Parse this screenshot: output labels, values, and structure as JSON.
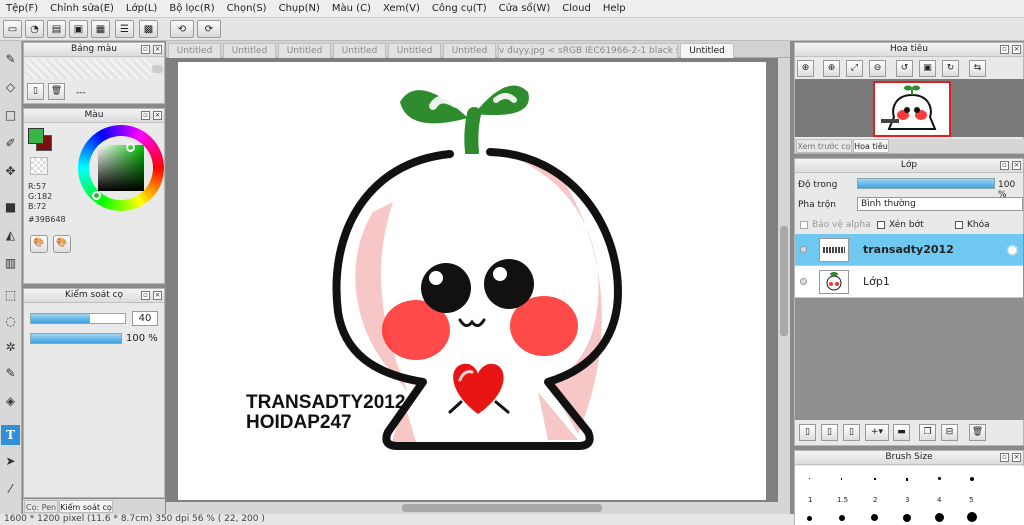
{
  "menu": [
    "Tệp(F)",
    "Chỉnh sửa(E)",
    "Lớp(L)",
    "Bộ lọc(R)",
    "Chọn(S)",
    "Chụp(N)",
    "Màu (C)",
    "Xem(V)",
    "Công cụ(T)",
    "Cửa sổ(W)",
    "Cloud",
    "Help"
  ],
  "tabs": [
    "Untitled",
    "Untitled",
    "Untitled",
    "Untitled",
    "Untitled",
    "Untitled",
    "v đuyy.jpg < sRGB IEC61966-2-1 black scaled >",
    "Untitled"
  ],
  "swatch_panel": {
    "title": "Bảng màu",
    "value": "---"
  },
  "color_panel": {
    "title": "Màu",
    "r": "R:57",
    "g": "G:182",
    "b": "B:72",
    "hex": "#39B648",
    "fg": "#39B648",
    "bg": "#7a1010"
  },
  "brush_control": {
    "title": "Kiểm soát cọ",
    "size": "40",
    "size_fill": 0.63,
    "opacity": "100 %",
    "opacity_fill": 1.0
  },
  "bottom_tabs": [
    "Cọ: Pen",
    "Kiểm soát cọ"
  ],
  "navigator": {
    "title": "Hoa tiêu",
    "tabs": [
      "Xem trước cọ",
      "Hoa tiêu"
    ]
  },
  "layers": {
    "title": "Lớp",
    "opacity_label": "Độ trong",
    "opacity_value": "100 %",
    "blend_label": "Pha trộn",
    "blend_value": "Bình thường",
    "options": [
      "Bảo vệ alpha",
      "Xén bớt",
      "Khóa"
    ],
    "items": [
      {
        "name": "transadty2012",
        "selected": true
      },
      {
        "name": "Lớp1",
        "selected": false
      }
    ]
  },
  "brush_size": {
    "title": "Brush Size",
    "values": [
      "1",
      "1.5",
      "2",
      "3",
      "4",
      "5"
    ]
  },
  "artwork": {
    "line1": "TRANSADTY2012",
    "line2": "HOIDAP247"
  },
  "status": "1600 * 1200 pixel   (11.6 * 8.7cm)   350 dpi   56 %   ( 22, 200 )",
  "colors": {
    "accent": "#3ea2e0",
    "selected_layer": "#6ec8f0",
    "leaf": "#2e8b2e",
    "blush": "#ff2a2a",
    "heart": "#e81515"
  }
}
